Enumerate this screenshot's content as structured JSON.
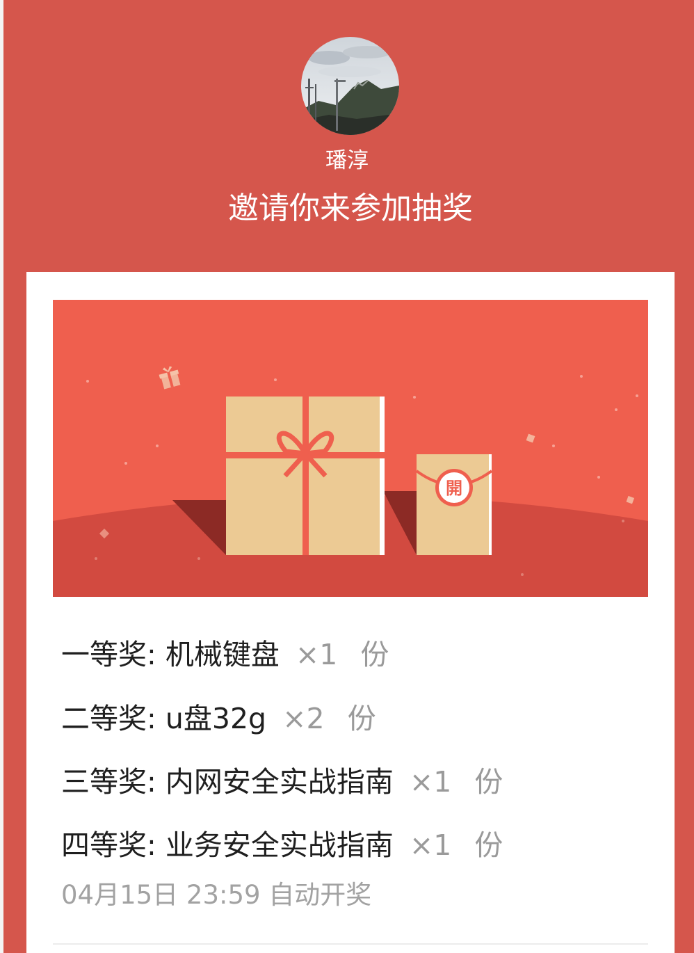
{
  "header": {
    "username": "璠淳",
    "headline": "邀请你来参加抽奖"
  },
  "banner": {
    "seal_char": "開"
  },
  "prizes": [
    {
      "tier": "一等奖:",
      "item": "机械键盘",
      "qty": "×1",
      "unit": "份"
    },
    {
      "tier": "二等奖:",
      "item": "u盘32g",
      "qty": "×2",
      "unit": "份"
    },
    {
      "tier": "三等奖:",
      "item": "内网安全实战指南",
      "qty": "×1",
      "unit": "份"
    },
    {
      "tier": "四等奖:",
      "item": "业务安全实战指南",
      "qty": "×1",
      "unit": "份"
    }
  ],
  "draw_time": "04月15日 23:59 自动开奖",
  "colors": {
    "background": "#d5564c",
    "banner_sky": "#ef5f4e",
    "banner_ground": "#d24a40",
    "gift_box": "#ecca94",
    "ribbon": "#ef5f4e"
  },
  "icons": {
    "avatar": "avatar-photo",
    "gift": "gift-box-icon",
    "red_packet": "red-packet-icon"
  }
}
